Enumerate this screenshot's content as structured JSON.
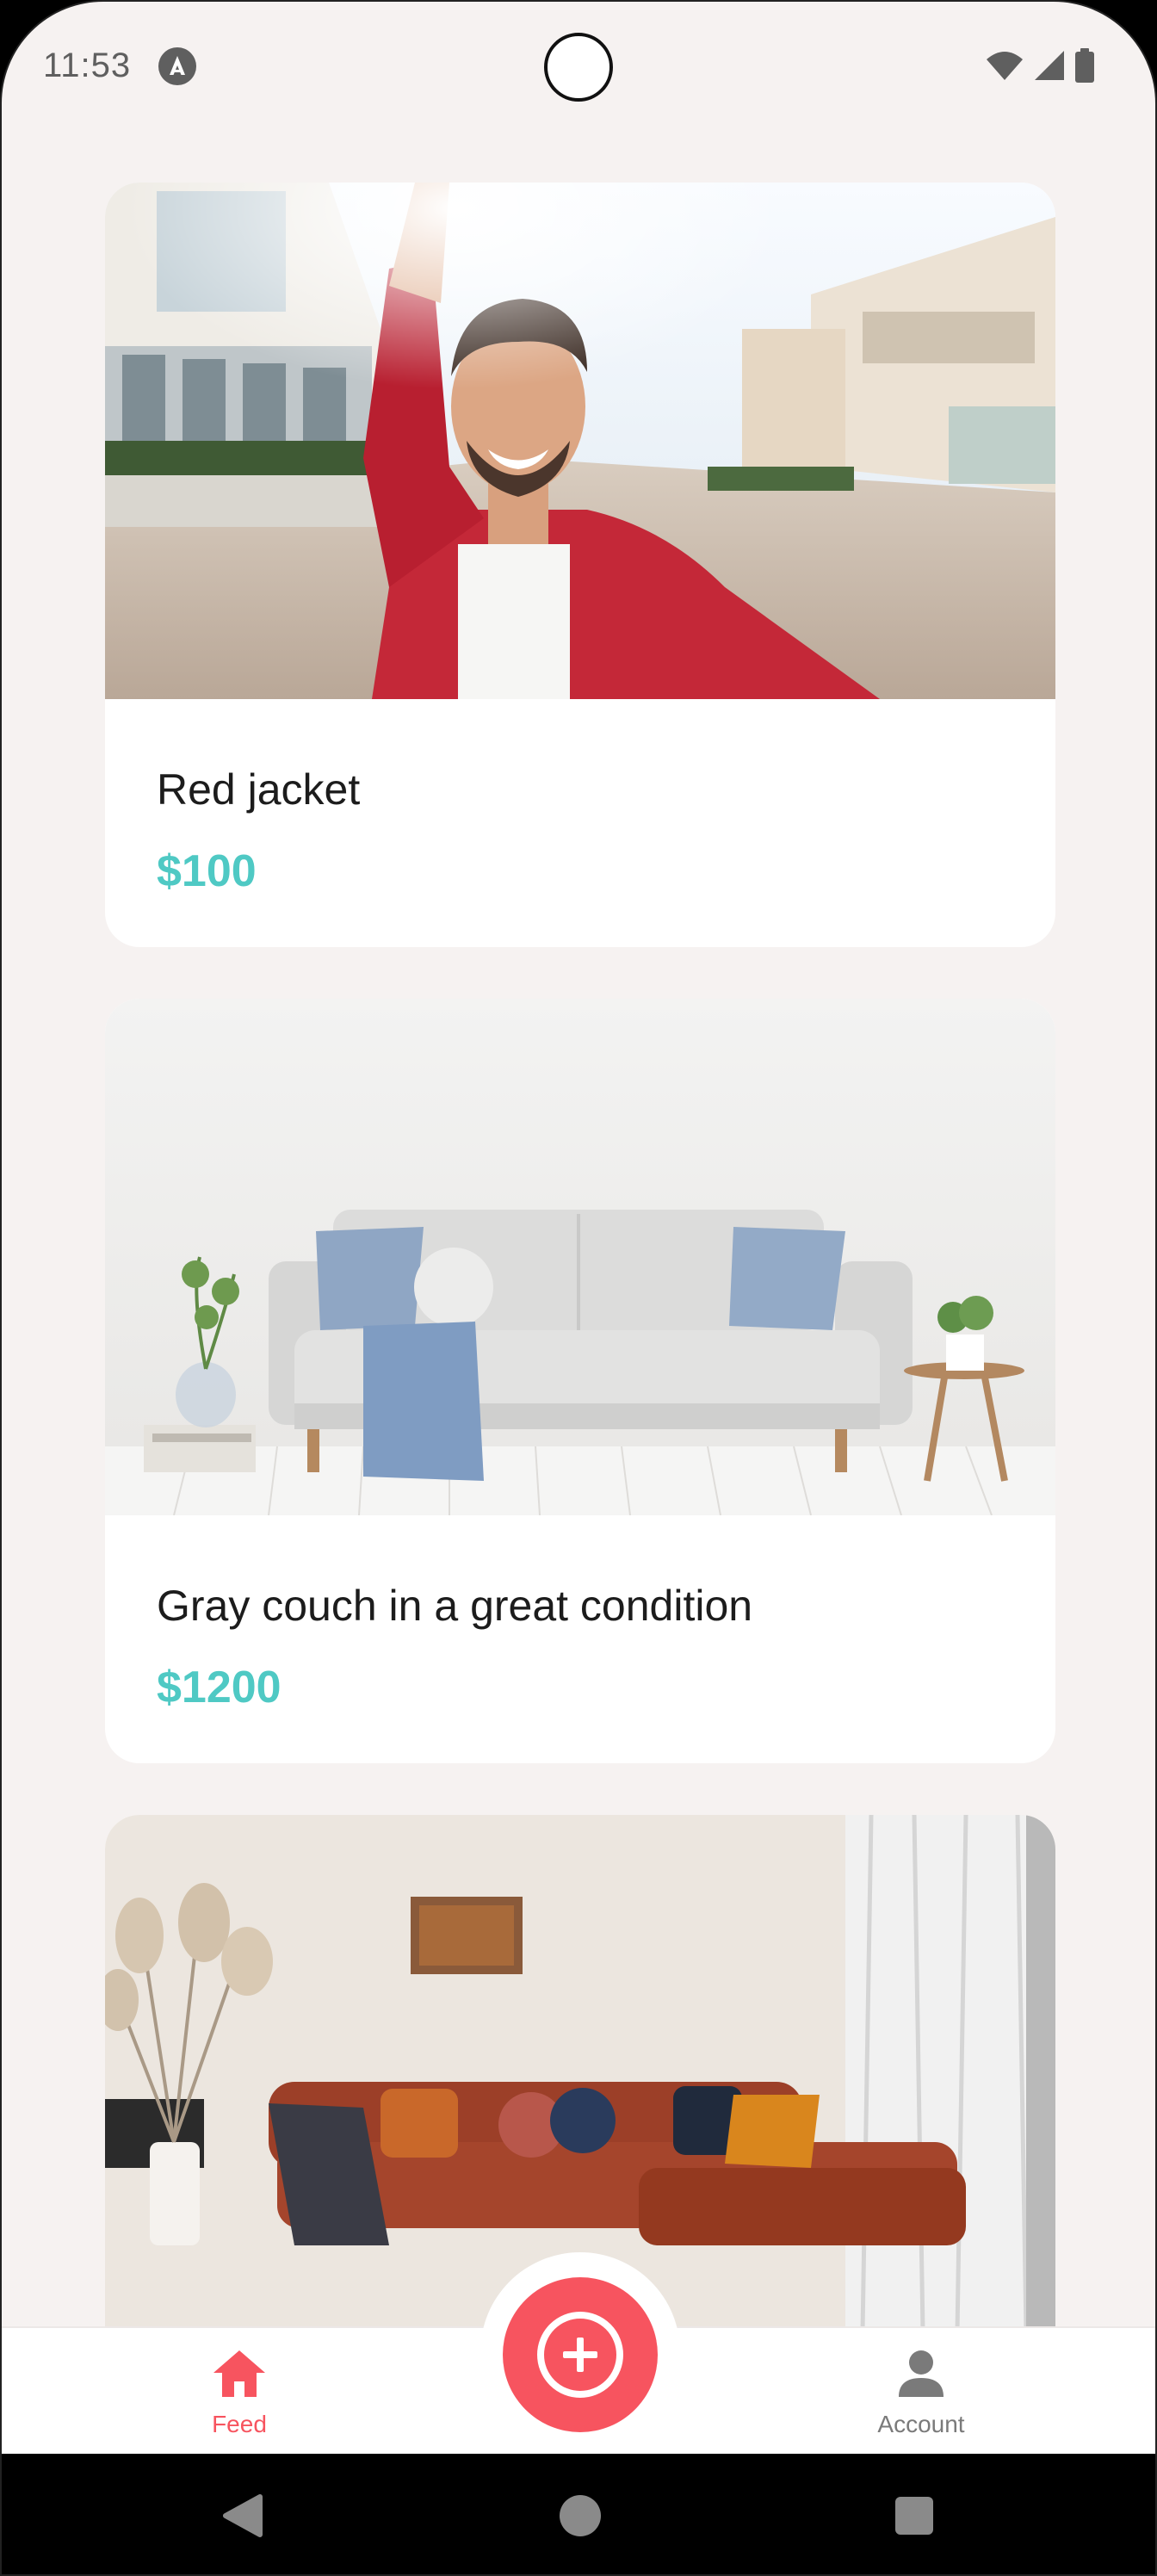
{
  "status_bar": {
    "time": "11:53"
  },
  "feed": {
    "items": [
      {
        "title": "Red jacket",
        "price": "$100"
      },
      {
        "title": "Gray couch in a great condition",
        "price": "$1200"
      },
      {
        "title": "",
        "price": ""
      }
    ]
  },
  "bottom_nav": {
    "feed_label": "Feed",
    "account_label": "Account"
  },
  "colors": {
    "background": "#f6f2f1",
    "accent": "#f7545f",
    "price": "#4fc9c4",
    "inactive_nav": "#7a7a7a"
  },
  "icons": {
    "feed": "home-icon",
    "account": "person-icon",
    "fab": "add-circle-icon",
    "system_back": "triangle-back-icon",
    "system_home": "circle-home-icon",
    "system_recents": "square-recents-icon"
  }
}
